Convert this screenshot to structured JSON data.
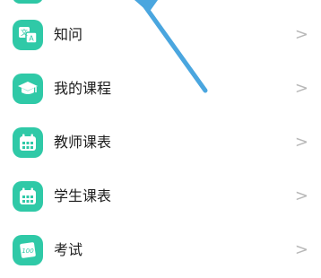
{
  "menu": {
    "items": [
      {
        "label": "知问",
        "icon": "translate-icon",
        "chevron": ">"
      },
      {
        "label": "我的课程",
        "icon": "graduation-cap-icon",
        "chevron": ">"
      },
      {
        "label": "教师课表",
        "icon": "calendar-icon",
        "chevron": ">"
      },
      {
        "label": "学生课表",
        "icon": "calendar-icon",
        "chevron": ">"
      },
      {
        "label": "考试",
        "icon": "exam-paper-icon",
        "icon_text": "100",
        "chevron": ">"
      }
    ]
  },
  "colors": {
    "icon_bg": "#2fc9a7",
    "arrow": "#4aa6df",
    "chevron": "#b8b8b8"
  }
}
